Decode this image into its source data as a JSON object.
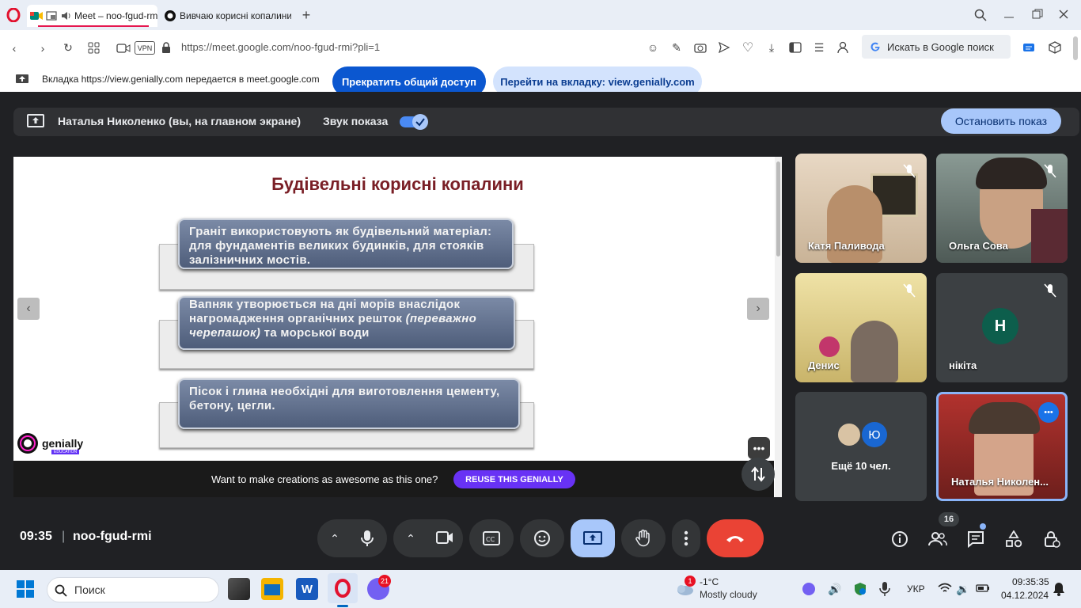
{
  "browser": {
    "tabs": [
      {
        "label": "Meet – noo-fgud-rmi"
      },
      {
        "label": "Вивчаю корисні копалини"
      }
    ],
    "url": "https://meet.google.com/noo-fgud-rmi?pli=1",
    "vpn_label": "VPN",
    "search_placeholder": "Искать в Google поиск"
  },
  "share_banner": {
    "text": "Вкладка https://view.genially.com передается в meet.google.com",
    "stop_button": "Прекратить общий доступ",
    "goto_button": "Перейти на вкладку: view.genially.com"
  },
  "presentation_bar": {
    "presenter": "Наталья Николенко (вы, на главном экране)",
    "sound_label": "Звук показа",
    "sound_enabled": true,
    "stop_button": "Остановить показ"
  },
  "slide": {
    "title": "Будівельні корисні копалини",
    "cards": [
      {
        "text": "Граніт використовують як будівельний матеріал: для фундаментів великих будинків, для стояків залізничних мостів."
      },
      {
        "text_before": "Вапняк утворюється на дні морів внаслідок нагромадження органічних решток ",
        "text_italic": "(переважно черепашок)",
        "text_after": " та морської води"
      },
      {
        "text": "Пісок і глина необхідні для виготовлення цементу, бетону, цегли."
      }
    ],
    "logo_text": "genially",
    "logo_sub": "EDUCATION",
    "reuse_text": "Want to make creations as awesome as this one?",
    "reuse_button": "REUSE THIS GENIALLY"
  },
  "participants": [
    {
      "name": "Катя Паливода",
      "muted": true
    },
    {
      "name": "Ольга Сова",
      "muted": true
    },
    {
      "name": "Денис",
      "muted": true
    },
    {
      "name": "нікіта",
      "muted": true,
      "initial": "Н"
    },
    {
      "name": "Ещё 10 чел.",
      "initial": "Ю"
    },
    {
      "name": "Наталья Николен..."
    }
  ],
  "bottom": {
    "time": "09:35",
    "separator": "|",
    "meeting_code": "noo-fgud-rmi",
    "participant_count": "16"
  },
  "taskbar": {
    "search": "Поиск",
    "viber_badge": "21",
    "weather_badge": "1",
    "temp": "-1°C",
    "weather": "Mostly cloudy",
    "lang": "УКР",
    "time": "09:35:35",
    "date": "04.12.2024"
  },
  "colors": {
    "meet_bg": "#202124",
    "end_call": "#ea4335",
    "accent_blue": "#0b57d0",
    "present_active": "#a8c7fa",
    "genially_purple": "#6832f5"
  }
}
